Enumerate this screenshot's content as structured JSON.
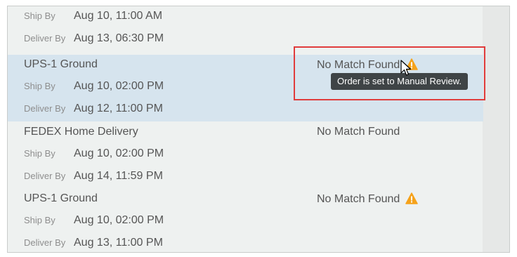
{
  "colors": {
    "warning": "#f5a21a",
    "highlight_row": "#d6e4ee",
    "callout": "#e03c3c",
    "tooltip_bg": "#3f4446"
  },
  "rows": [
    {
      "ship_label": "Ship By",
      "ship_value": "Aug 10, 11:00 AM",
      "deliver_label": "Deliver By",
      "deliver_value": "Aug 13, 06:30 PM"
    },
    {
      "carrier": "UPS-1 Ground",
      "status": "No Match Found",
      "status_icon": "warning-icon",
      "ship_label": "Ship By",
      "ship_value": "Aug 10, 02:00 PM",
      "deliver_label": "Deliver By",
      "deliver_value": "Aug 12, 11:00 PM"
    },
    {
      "carrier": "FEDEX Home Delivery",
      "status": "No Match Found",
      "ship_label": "Ship By",
      "ship_value": "Aug 10, 02:00 PM",
      "deliver_label": "Deliver By",
      "deliver_value": "Aug 14, 11:59 PM"
    },
    {
      "carrier": "UPS-1 Ground",
      "status": "No Match Found",
      "status_icon": "warning-icon",
      "ship_label": "Ship By",
      "ship_value": "Aug 10, 02:00 PM",
      "deliver_label": "Deliver By",
      "deliver_value": "Aug 13, 11:00 PM"
    }
  ],
  "tooltip": {
    "text": "Order is set to Manual Review."
  }
}
